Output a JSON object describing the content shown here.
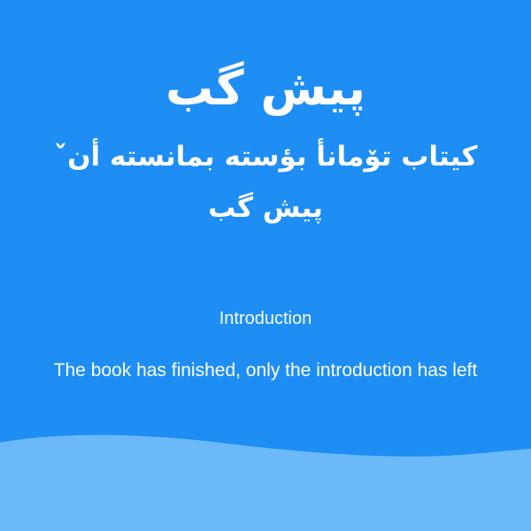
{
  "title": "پیش گب",
  "subtitle": "کیتاب تۆمانأ بؤسته بمانسته أنˇ پیش گب",
  "intro": {
    "heading": "Introduction",
    "text": "The book has finished, only the introduction has left"
  },
  "colors": {
    "background": "#1e8ef5",
    "wave": "#6cb9fa",
    "text": "#ffffff"
  }
}
